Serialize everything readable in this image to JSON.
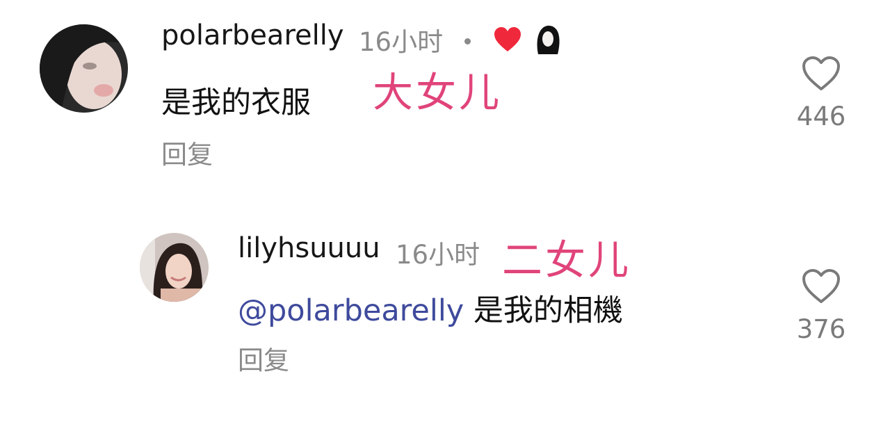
{
  "comments": [
    {
      "username": "polarbearelly",
      "time": "16小时",
      "text": "是我的衣服",
      "reply_label": "回复",
      "likes": "446",
      "annotation": "大女儿",
      "creator_liked": true,
      "icons": [
        "heart-outline-icon",
        "heart-filled-icon"
      ]
    },
    {
      "username": "lilyhsuuuu",
      "time": "16小时",
      "mention": "@polarbearelly",
      "text": "是我的相機",
      "reply_label": "回复",
      "likes": "376",
      "annotation": "二女儿"
    }
  ],
  "colors": {
    "annotation": "#e0447a",
    "mention": "#3e4a9c",
    "creator_heart": "#f0283c",
    "meta_text": "#8a8a8a"
  }
}
